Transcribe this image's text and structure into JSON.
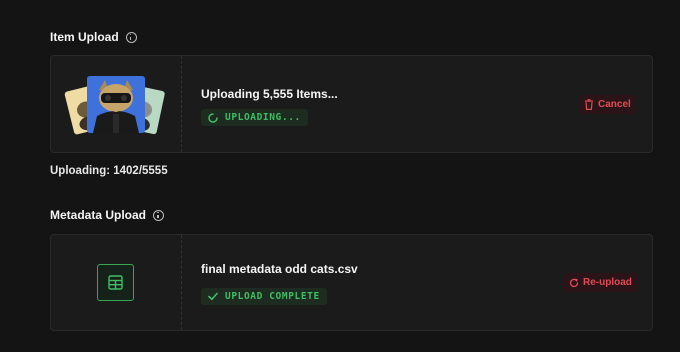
{
  "item_upload": {
    "title": "Item Upload",
    "file_title": "Uploading 5,555 Items...",
    "status": "UPLOADING...",
    "cancel_label": "Cancel",
    "progress_text": "Uploading: 1402/5555",
    "progress_current": 1402,
    "progress_total": 5555
  },
  "metadata_upload": {
    "title": "Metadata Upload",
    "file_title": "final metadata odd cats.csv",
    "status": "UPLOAD COMPLETE",
    "reupload_label": "Re-upload"
  },
  "icons": {
    "info": "info-circle-icon",
    "spinner": "spinner-icon",
    "trash": "trash-icon",
    "check": "check-icon",
    "refresh": "refresh-icon",
    "table": "table-icon"
  },
  "colors": {
    "background": "#141414",
    "card": "#1b1b1b",
    "success": "#3fbf63",
    "danger": "#e04c55"
  }
}
